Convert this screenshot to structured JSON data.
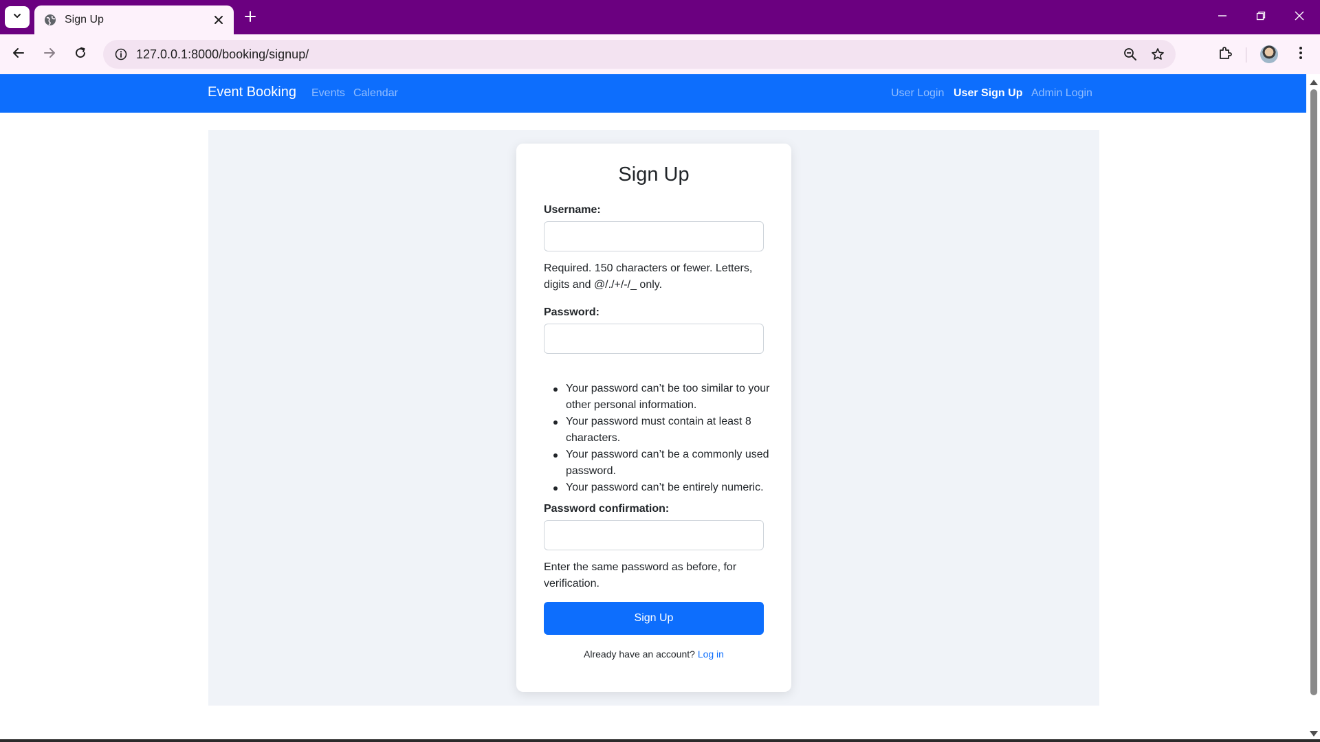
{
  "browser": {
    "tab_title": "Sign Up",
    "url": "127.0.0.1:8000/booking/signup/"
  },
  "navbar": {
    "brand": "Event Booking",
    "links": [
      "Events",
      "Calendar"
    ],
    "right_links": [
      "User Login",
      "User Sign Up",
      "Admin Login"
    ],
    "active_link": "User Sign Up",
    "color": "#0d6efd"
  },
  "form": {
    "title": "Sign Up",
    "username_label": "Username:",
    "username_help_1": "Required. 150 characters or fewer. Letters,",
    "username_help_2": "digits and @/./+/-/_ only.",
    "password_label": "Password:",
    "password_rules": [
      "Your password can’t be too similar to your other personal information.",
      "Your password must contain at least 8 characters.",
      "Your password can’t be a commonly used password.",
      "Your password can’t be entirely numeric."
    ],
    "confirm_label": "Password confirmation:",
    "confirm_help_1": "Enter the same password as before, for",
    "confirm_help_2": "verification.",
    "submit_label": "Sign Up",
    "login_prompt": "Already have an account?",
    "login_link": "Log in"
  },
  "icons": {
    "tab_search": "chevron-down-icon",
    "favicon": "globe-icon",
    "tab_close": "close-icon",
    "new_tab": "plus-icon",
    "back": "arrow-left-icon",
    "forward": "arrow-right-icon",
    "reload": "reload-icon",
    "site_info": "info-icon",
    "zoom": "zoom-out-icon",
    "bookmark": "star-icon",
    "extensions": "puzzle-icon",
    "menu": "kebab-menu-icon"
  }
}
